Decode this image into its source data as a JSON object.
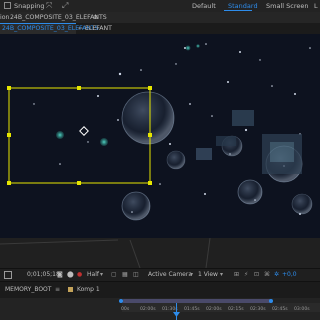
{
  "toolbar": {
    "snapping_label": "Snapping",
    "workspaces": [
      {
        "label": "Default",
        "active": false
      },
      {
        "label": "Standard",
        "active": true
      },
      {
        "label": "Small Screen",
        "active": false
      },
      {
        "label": "L",
        "active": false
      }
    ]
  },
  "composition": {
    "header_prefix": "ion",
    "name": "24B_COMPOSITE_03_ELEFANTS",
    "tabs": [
      "24B_COMPOSITE_03_ELEFANTS",
      "ELEFANT"
    ]
  },
  "viewer_bar": {
    "zoom": "",
    "timecode": "0;01;05;18",
    "resolution": "Half",
    "camera": "Active Camera",
    "views": "1 View",
    "exposure": "+0,0"
  },
  "timeline": {
    "tabs": [
      "MEMORY_BOOT",
      "Komp 1"
    ],
    "ruler_labels": [
      "00s",
      "02:00s",
      "01:30s",
      "01:45s",
      "02:00s",
      "02:15s",
      "02:30s",
      "02:45s",
      "03:00s"
    ]
  },
  "colors": {
    "accent": "#2d8ceb",
    "selection": "#e6e600",
    "viewer_bg": "#0b0f1a"
  }
}
